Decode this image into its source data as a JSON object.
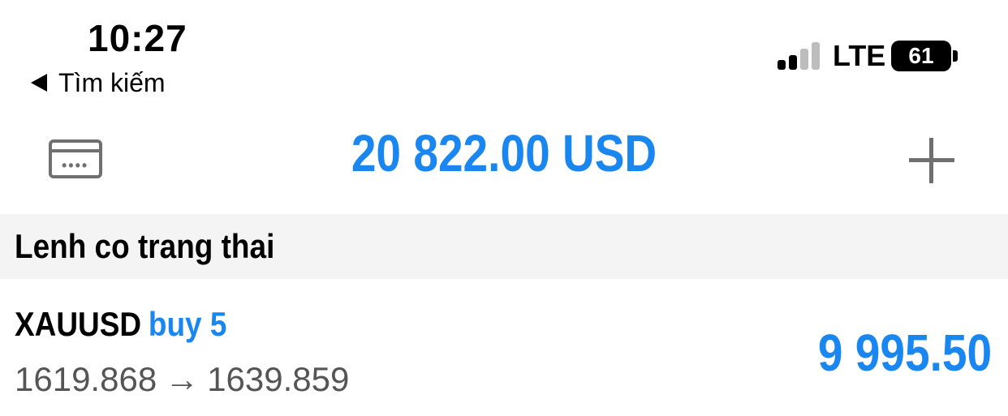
{
  "status_bar": {
    "time": "10:27",
    "back_label": "Tìm kiếm",
    "network": "LTE",
    "battery": "61",
    "signal_bars_active": 2
  },
  "header": {
    "balance": "20 822.00 USD",
    "card_icon": "credit-card-icon",
    "add_icon": "plus-icon"
  },
  "section": {
    "title": "Lenh co trang thai"
  },
  "orders": [
    {
      "symbol": "XAUUSD",
      "side": "buy 5",
      "open_price": "1619.868",
      "arrow": "→",
      "current_price": "1639.859",
      "profit": "9 995.50"
    }
  ],
  "colors": {
    "accent": "#1a87f0",
    "icon_gray": "#707070",
    "section_bg": "#f4f4f4",
    "secondary_text": "#555555"
  }
}
